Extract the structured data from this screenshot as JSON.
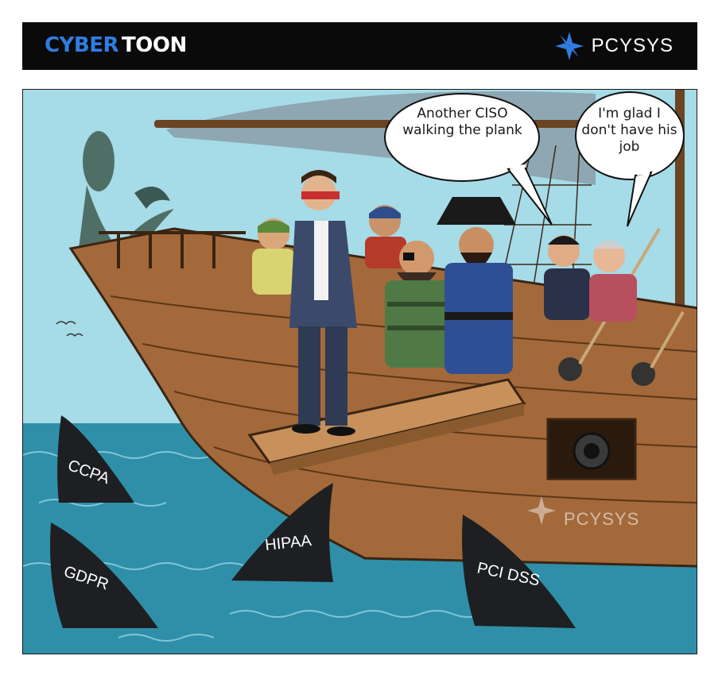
{
  "header": {
    "brand_cyber": "CYBER",
    "brand_toon": "TOON",
    "logo_text": "PCYSYS",
    "background": "#0a0a0a",
    "accent": "#2f7de1"
  },
  "cartoon": {
    "speech_bubble_1": "Another CISO walking the plank",
    "speech_bubble_2": "I'm glad I don't have his job",
    "watermark": "PCYSYS",
    "sharks": [
      "CCPA",
      "GDPR",
      "HIPAA",
      "PCI DSS"
    ],
    "icons": [
      "pcysys-logo-icon",
      "pirate-ship",
      "shark-fin"
    ],
    "colors": {
      "sky": "#9fd8e6",
      "sea": "#2f8fa8",
      "hull": "#a3693a",
      "fin": "#1d1f22"
    }
  }
}
